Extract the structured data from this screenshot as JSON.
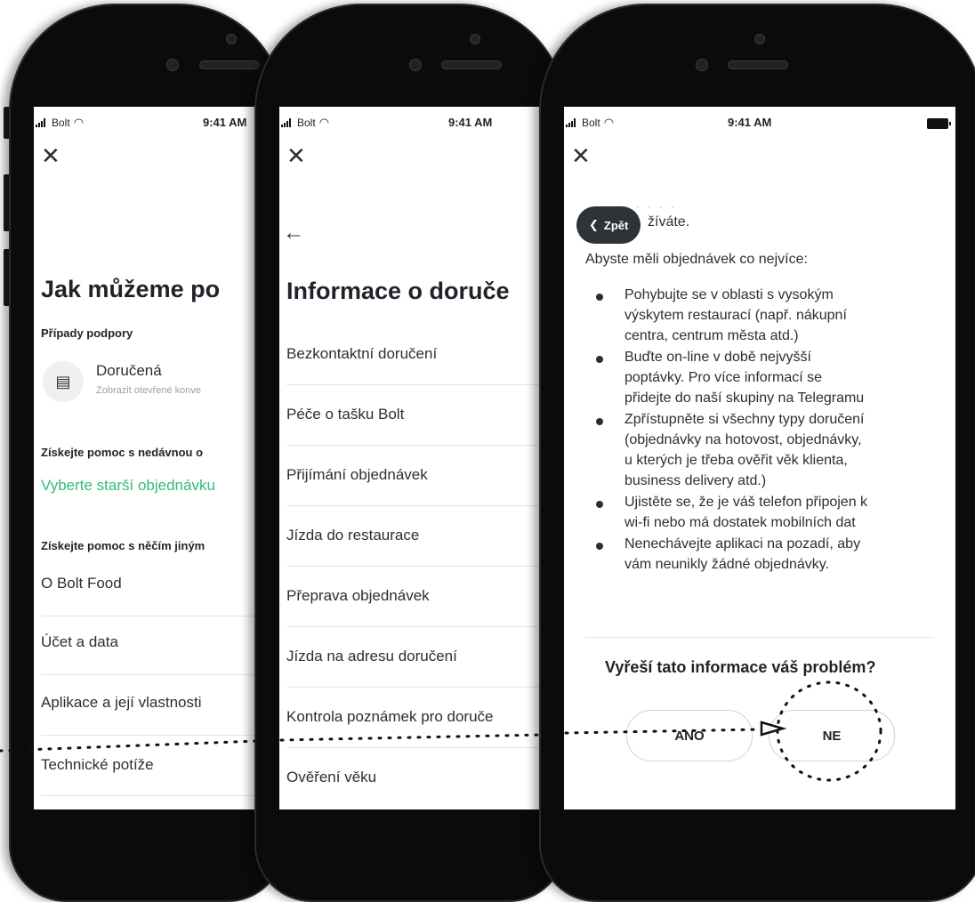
{
  "status": {
    "carrier": "Bolt",
    "time": "9:41 AM"
  },
  "screen1": {
    "title": "Jak můžeme po",
    "support_cases_label": "Případy podpory",
    "case_title": "Doručená",
    "case_subtitle": "Zobrazit otevřené konve",
    "recent_help_label": "Získejte pomoc s nedávnou o",
    "select_order_link": "Vyberte starší objednávku",
    "other_help_label": "Získejte pomoc s něčím jiným",
    "items": [
      "O Bolt Food",
      "Účet a data",
      "Aplikace a její vlastnosti",
      "Technické potíže"
    ]
  },
  "screen2": {
    "title": "Informace o doruče",
    "items": [
      "Bezkontaktní doručení",
      "Péče o tašku Bolt",
      "Přijímání objednávek",
      "Jízda do restaurace",
      "Přeprava objednávek",
      "Jízda na adresu doručení",
      "Kontrola poznámek pro doruče",
      "Ověření věku"
    ]
  },
  "screen3": {
    "back_button": "Zpět",
    "partial_line": "žíváte.",
    "intro": "Abyste měli objednávek co nejvíce:",
    "bullets": [
      [
        "Pohybujte se v oblasti s vysokým",
        "výskytem restaurací (např. nákupní",
        "centra, centrum města atd.)"
      ],
      [
        "Buďte on-line v době nejvyšší",
        "poptávky. Pro více informací se",
        "přidejte do naší skupiny na Telegramu"
      ],
      [
        "Zpřístupněte si všechny typy doručení",
        "(objednávky na hotovost, objednávky,",
        "u kterých je třeba ověřit věk klienta,",
        "business delivery atd.)"
      ],
      [
        "Ujistěte se, že je váš telefon připojen k",
        "wi-fi nebo má dostatek mobilních dat"
      ],
      [
        "Nenechávejte aplikaci na pozadí, aby",
        "vám neunikly žádné objednávky."
      ]
    ],
    "question": "Vyřeší tato informace váš problém?",
    "yes_label": "ANO",
    "no_label": "NE"
  }
}
